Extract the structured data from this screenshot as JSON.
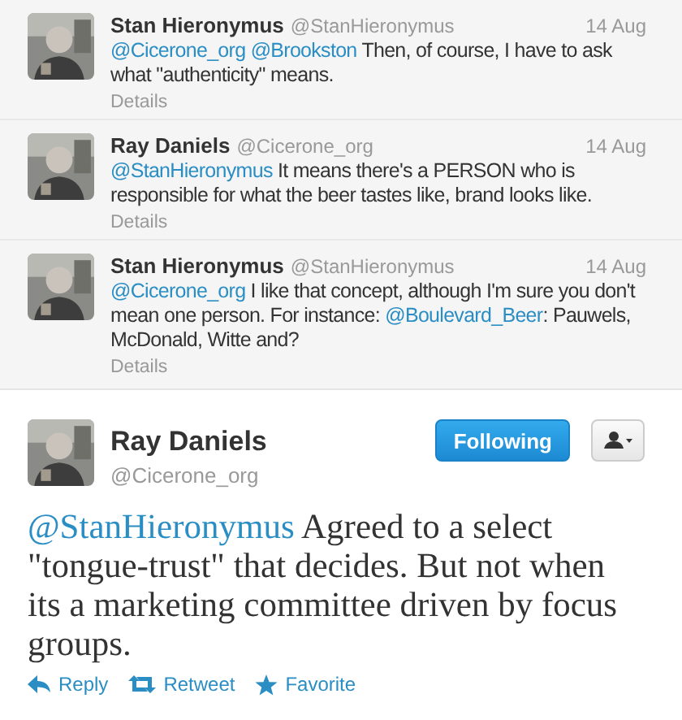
{
  "replies": [
    {
      "name": "Stan Hieronymus",
      "handle": "@StanHieronymus",
      "date": "14 Aug",
      "text": [
        {
          "kind": "mention",
          "text": "@Cicerone_org "
        },
        {
          "kind": "mention",
          "text": "@Brookston"
        },
        {
          "kind": "text",
          "text": " Then, of course, I have to ask what \"authenticity\" means."
        }
      ],
      "details": "Details"
    },
    {
      "name": "Ray Daniels",
      "handle": "@Cicerone_org",
      "date": "14 Aug",
      "text": [
        {
          "kind": "mention",
          "text": "@StanHieronymus"
        },
        {
          "kind": "text",
          "text": " It means there's a PERSON who is responsible for what the beer tastes like, brand looks like."
        }
      ],
      "details": "Details"
    },
    {
      "name": "Stan Hieronymus",
      "handle": "@StanHieronymus",
      "date": "14 Aug",
      "text": [
        {
          "kind": "mention",
          "text": "@Cicerone_org"
        },
        {
          "kind": "text",
          "text": " I like that concept, although I'm sure you don't mean one person. For instance: "
        },
        {
          "kind": "mention",
          "text": "@Boulevard_Beer"
        },
        {
          "kind": "text",
          "text": ": Pauwels, McDonald, Witte and?"
        }
      ],
      "details": "Details"
    }
  ],
  "tweet": {
    "name": "Ray Daniels",
    "handle": "@Cicerone_org",
    "follow_button": "Following",
    "text": [
      {
        "kind": "mention",
        "text": "@StanHieronymus"
      },
      {
        "kind": "text",
        "text": " Agreed to a select \"tongue-trust\" that decides. But not when its a marketing committee driven by focus groups."
      }
    ],
    "actions": [
      {
        "kind": "reply",
        "label": "Reply"
      },
      {
        "kind": "retweet",
        "label": "Retweet"
      },
      {
        "kind": "favorite",
        "label": "Favorite"
      }
    ]
  }
}
